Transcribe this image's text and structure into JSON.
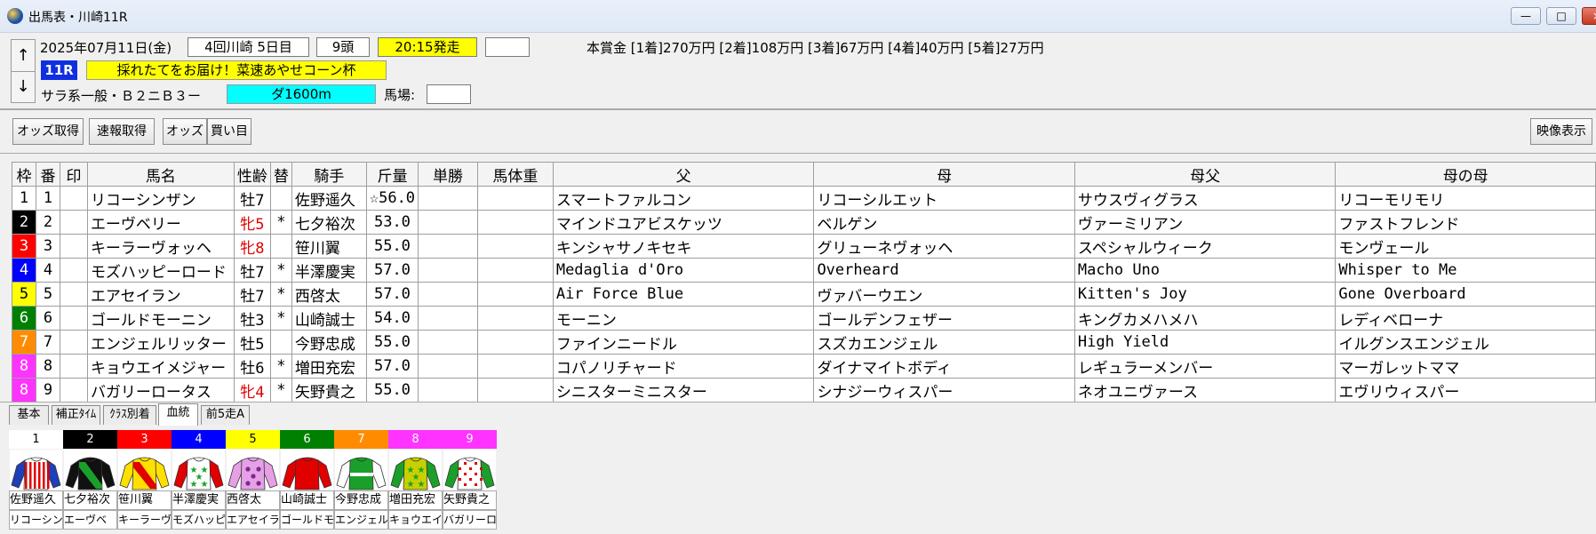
{
  "window": {
    "title": "出馬表・川崎11R",
    "min": "—",
    "max": "□",
    "close": "×"
  },
  "race": {
    "date": "2025年07月11日(金)",
    "meeting": "4回川崎 5日目",
    "runners": "9頭",
    "post_time": "20:15発走",
    "empty_field": "",
    "prize": "本賞金 [1着]270万円 [2着]108万円 [3着]67万円 [4着]40万円 [5着]27万円",
    "race_no": "11R",
    "race_name": "採れたてをお届け！菜速あやせコーン杯",
    "class": "サラ系一般・Ｂ２ニＢ３ー",
    "distance": "ダ1600m",
    "going_label": "馬場:",
    "going_value": ""
  },
  "nav": {
    "up": "↑",
    "down": "↓"
  },
  "toolbar": {
    "odds_fetch": "オッズ取得",
    "flash_fetch": "速報取得",
    "odds": "オッズ",
    "bets": "買い目",
    "video": "映像表示"
  },
  "table": {
    "headers": [
      "枠",
      "番",
      "印",
      "馬名",
      "性齢",
      "替",
      "騎手",
      "斤量",
      "単勝",
      "馬体重",
      "父",
      "母",
      "母父",
      "母の母"
    ],
    "rows": [
      {
        "waku": "1",
        "ban": "1",
        "mark": "",
        "name": "リコーシンザン",
        "sexage": "牡7",
        "red": false,
        "change": "",
        "jockey": "佐野遥久",
        "weight": "☆56.0",
        "win": "",
        "body": "",
        "sire": "スマートファルコン",
        "dam": "リコーシルエット",
        "damsire": "サウスヴィグラス",
        "dam_dam": "リコーモリモリ"
      },
      {
        "waku": "2",
        "ban": "2",
        "mark": "",
        "name": "エーヴベリー",
        "sexage": "牝5",
        "red": true,
        "change": "*",
        "jockey": "七夕裕次",
        "weight": "53.0",
        "win": "",
        "body": "",
        "sire": "マインドユアビスケッツ",
        "dam": "ベルゲン",
        "damsire": "ヴァーミリアン",
        "dam_dam": "ファストフレンド"
      },
      {
        "waku": "3",
        "ban": "3",
        "mark": "",
        "name": "キーラーヴォッヘ",
        "sexage": "牝8",
        "red": true,
        "change": "",
        "jockey": "笹川翼",
        "weight": "55.0",
        "win": "",
        "body": "",
        "sire": "キンシャサノキセキ",
        "dam": "グリューネヴォッヘ",
        "damsire": "スペシャルウィーク",
        "dam_dam": "モンヴェール"
      },
      {
        "waku": "4",
        "ban": "4",
        "mark": "",
        "name": "モズハッピーロード",
        "sexage": "牡7",
        "red": false,
        "change": "*",
        "jockey": "半澤慶実",
        "weight": "57.0",
        "win": "",
        "body": "",
        "sire": "Medaglia d'Oro",
        "dam": "Overheard",
        "damsire": "Macho Uno",
        "dam_dam": "Whisper to Me"
      },
      {
        "waku": "5",
        "ban": "5",
        "mark": "",
        "name": "エアセイラン",
        "sexage": "牡7",
        "red": false,
        "change": "*",
        "jockey": "西啓太",
        "weight": "57.0",
        "win": "",
        "body": "",
        "sire": "Air Force Blue",
        "dam": "ヴァバーウエン",
        "damsire": "Kitten's Joy",
        "dam_dam": "Gone Overboard"
      },
      {
        "waku": "6",
        "ban": "6",
        "mark": "",
        "name": "ゴールドモーニン",
        "sexage": "牡3",
        "red": false,
        "change": "*",
        "jockey": "山崎誠士",
        "weight": "54.0",
        "win": "",
        "body": "",
        "sire": "モーニン",
        "dam": "ゴールデンフェザー",
        "damsire": "キングカメハメハ",
        "dam_dam": "レディベローナ"
      },
      {
        "waku": "7",
        "ban": "7",
        "mark": "",
        "name": "エンジェルリッター",
        "sexage": "牡5",
        "red": false,
        "change": "",
        "jockey": "今野忠成",
        "weight": "55.0",
        "win": "",
        "body": "",
        "sire": "ファインニードル",
        "dam": "スズカエンジェル",
        "damsire": "High Yield",
        "dam_dam": "イルグンスエンジェル"
      },
      {
        "waku": "8",
        "ban": "8",
        "mark": "",
        "name": "キョウエイメジャー",
        "sexage": "牡6",
        "red": false,
        "change": "*",
        "jockey": "増田充宏",
        "weight": "57.0",
        "win": "",
        "body": "",
        "sire": "コパノリチャード",
        "dam": "ダイナマイトボディ",
        "damsire": "レギュラーメンバー",
        "dam_dam": "マーガレットママ"
      },
      {
        "waku": "8",
        "ban": "9",
        "mark": "",
        "name": "バガリーロータス",
        "sexage": "牝4",
        "red": true,
        "change": "*",
        "jockey": "矢野貴之",
        "weight": "55.0",
        "win": "",
        "body": "",
        "sire": "シニスターミニスター",
        "dam": "シナジーウィスパー",
        "damsire": "ネオユニヴァース",
        "dam_dam": "エヴリウィスパー"
      }
    ]
  },
  "waku_colors": {
    "1": {
      "bg": "#ffffff",
      "fg": "#000000"
    },
    "2": {
      "bg": "#000000",
      "fg": "#ffffff"
    },
    "3": {
      "bg": "#ff0000",
      "fg": "#ffffff"
    },
    "4": {
      "bg": "#0000ff",
      "fg": "#ffffff"
    },
    "5": {
      "bg": "#ffff00",
      "fg": "#000000"
    },
    "6": {
      "bg": "#008000",
      "fg": "#ffffff"
    },
    "7": {
      "bg": "#ff8c00",
      "fg": "#ffffff"
    },
    "8": {
      "bg": "#ff33ff",
      "fg": "#ffffff"
    }
  },
  "tabs": [
    "基本",
    "補正ﾀｲﾑ",
    "ｸﾗｽ別着",
    "血統",
    "前5走A"
  ],
  "active_tab": "血統",
  "silks": [
    {
      "num": "1",
      "jockey": "佐野遥久",
      "horse": "リコーシン",
      "body": "#ffffff",
      "accent": "#e00000",
      "sleeve": "#1d3fb8",
      "pattern": "stripes"
    },
    {
      "num": "2",
      "jockey": "七夕裕次",
      "horse": "エーヴベ",
      "body": "#111111",
      "accent": "#1aa02a",
      "sleeve": "#111111",
      "pattern": "sash"
    },
    {
      "num": "3",
      "jockey": "笹川翼",
      "horse": "キーラーヴ",
      "body": "#ffe000",
      "accent": "#e00000",
      "sleeve": "#ffe000",
      "pattern": "sash"
    },
    {
      "num": "4",
      "jockey": "半澤慶実",
      "horse": "モズハッピ",
      "body": "#ffffff",
      "accent": "#1aa02a",
      "sleeve": "#e00000",
      "pattern": "stars"
    },
    {
      "num": "5",
      "jockey": "西啓太",
      "horse": "エアセイラ",
      "body": "#e6a0e6",
      "accent": "#7b2a8a",
      "sleeve": "#e6a0e6",
      "pattern": "dots"
    },
    {
      "num": "6",
      "jockey": "山崎誠士",
      "horse": "ゴールドモ",
      "body": "#e00000",
      "accent": "#b00000",
      "sleeve": "#e00000",
      "pattern": "plain"
    },
    {
      "num": "7",
      "jockey": "今野忠成",
      "horse": "エンジェル",
      "body": "#1aa02a",
      "accent": "#ffffff",
      "sleeve": "#ffffff",
      "pattern": "bars"
    },
    {
      "num": "8",
      "jockey": "増田充宏",
      "horse": "キョウエイ",
      "body": "#c8d000",
      "accent": "#1aa02a",
      "sleeve": "#1aa02a",
      "pattern": "stars"
    },
    {
      "num": "9",
      "jockey": "矢野貴之",
      "horse": "バガリーロ",
      "body": "#ffffff",
      "accent": "#e00000",
      "sleeve": "#1aa02a",
      "pattern": "checks"
    }
  ]
}
